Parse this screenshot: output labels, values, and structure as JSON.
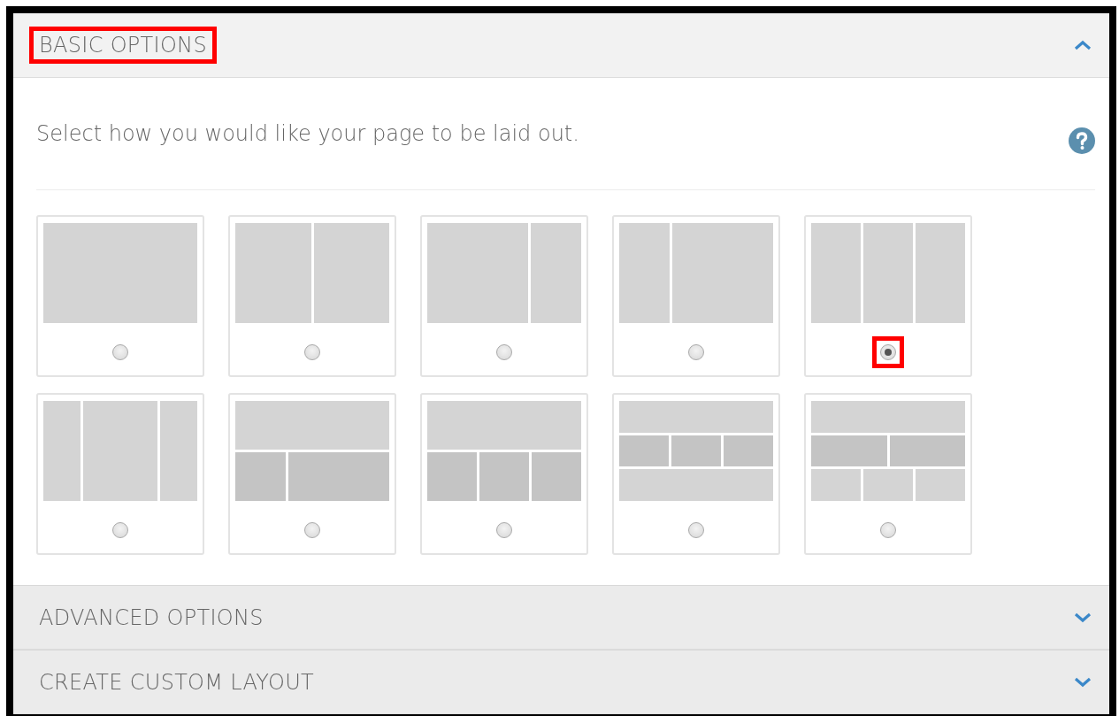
{
  "sections": [
    {
      "title": "BASIC OPTIONS",
      "expanded": true,
      "highlighted": true,
      "description": "Select how you would like your page to be laid out.",
      "layouts": [
        {
          "kind": "full",
          "selected": false,
          "highlighted": false
        },
        {
          "kind": "halves",
          "selected": false,
          "highlighted": false
        },
        {
          "kind": "wide-left",
          "selected": false,
          "highlighted": false
        },
        {
          "kind": "wide-right",
          "selected": false,
          "highlighted": false
        },
        {
          "kind": "thirds",
          "selected": true,
          "highlighted": true
        },
        {
          "kind": "wide-center",
          "selected": false,
          "highlighted": false
        },
        {
          "kind": "top-two",
          "selected": false,
          "highlighted": false
        },
        {
          "kind": "top-three",
          "selected": false,
          "highlighted": false
        },
        {
          "kind": "top-three-bottom",
          "selected": false,
          "highlighted": false
        },
        {
          "kind": "top-two-three",
          "selected": false,
          "highlighted": false
        }
      ]
    },
    {
      "title": "ADVANCED OPTIONS",
      "expanded": false,
      "highlighted": false
    },
    {
      "title": "CREATE CUSTOM LAYOUT",
      "expanded": false,
      "highlighted": false
    }
  ]
}
